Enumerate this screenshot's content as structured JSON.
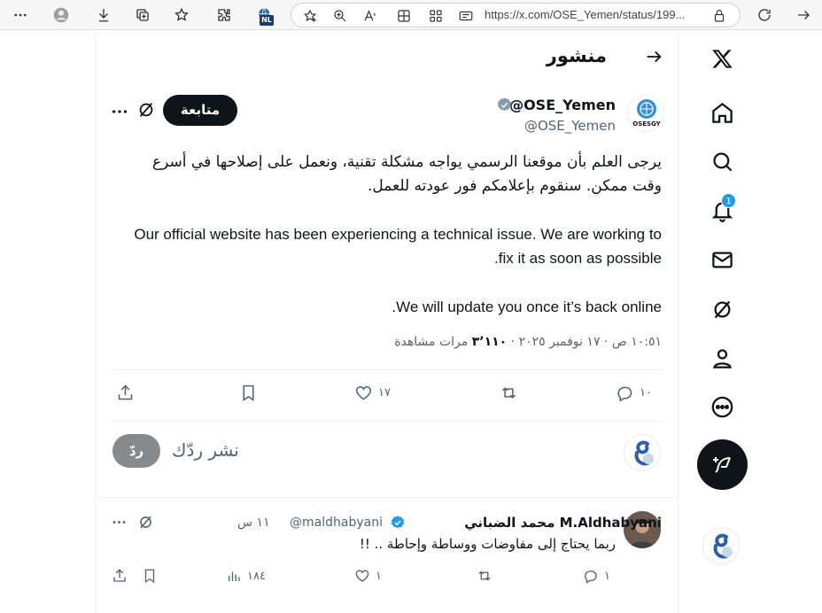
{
  "browser": {
    "url": "https://x.com/OSE_Yemen/status/199...",
    "profile_badge": "NL"
  },
  "header": {
    "title": "منشور"
  },
  "post": {
    "display_name": "@OSE_Yemen",
    "handle": "@OSE_Yemen",
    "avatar_label": "OSESGY",
    "follow_label": "متابعة",
    "body_ar": "يرجى العلم بأن موقعنا الرسمي يواجه مشكلة تقنية، ونعمل على إصلاحها في أسرع وقت ممكن. سنقوم بإعلامكم فور عودته للعمل.",
    "body_en_1": "Our official website has been experiencing a technical issue. We are working to fix it as soon as possible.",
    "body_en_2": "We will update you once it’s back online.",
    "meta_time": "١٠:٥١ ص · ١٧ نوفمبر ٢٠٢٥ · ",
    "views_count": "٣٬١١٠",
    "views_label": "مرات مشاهدة",
    "replies": "١٠",
    "likes": "١٧"
  },
  "reply_box": {
    "placeholder": "نشر ردّك",
    "button": "ردّ"
  },
  "reply": {
    "display_name": "M.Aldhabyani محمد الضباني",
    "handle": "@maldhabyani",
    "time": "١١ س",
    "text": "ربما يحتاج إلى مفاوضات ووساطة وإحاطة .. !!",
    "replies": "١",
    "likes": "١",
    "views": "١٨٤"
  },
  "nav": {
    "notifications_badge": "1"
  },
  "colors": {
    "accent": "#1d9bf0",
    "text": "#0f1419",
    "muted": "#536471"
  }
}
